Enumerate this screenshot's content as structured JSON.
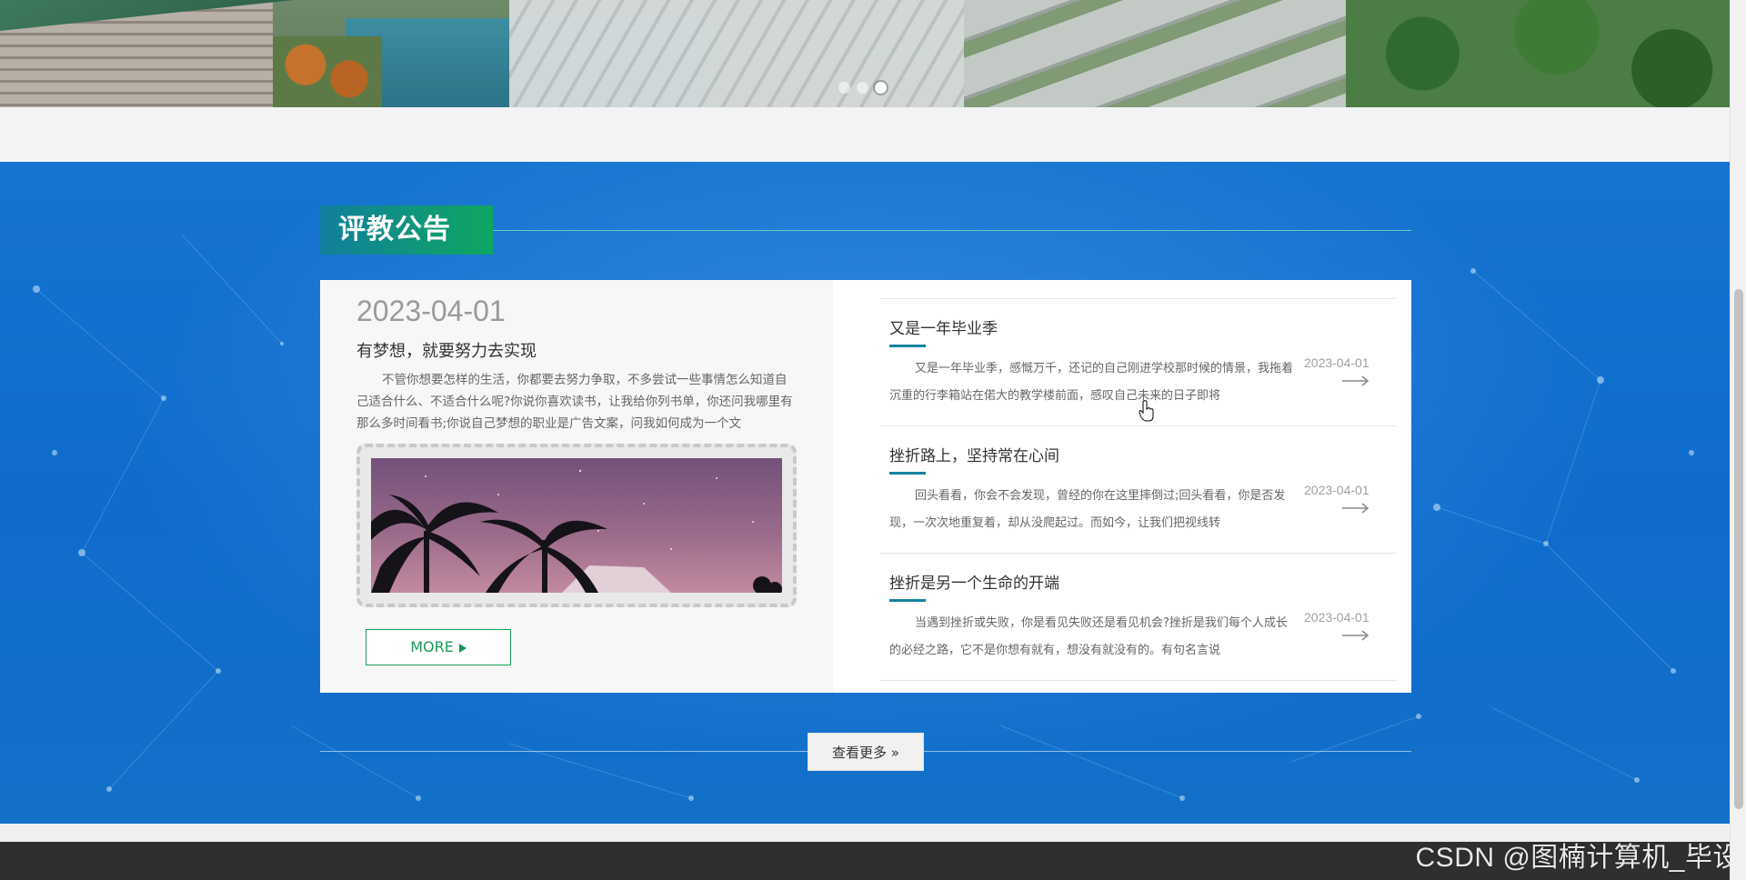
{
  "banner": {
    "slides": 3,
    "active_slide": 3
  },
  "section": {
    "title": "评教公告",
    "view_more_label": "查看更多 »",
    "colors": {
      "section_blue": "#1270c9",
      "title_green": "#0fa760",
      "title_teal": "#107f9c",
      "more_green": "#1a9a5a"
    }
  },
  "featured": {
    "date": "2023-04-01",
    "title": "有梦想，就要努力去实现",
    "text": "不管你想要怎样的生活，你都要去努力争取，不多尝试一些事情怎么知道自己适合什么、不适合什么呢?你说你喜欢读书，让我给你列书单，你还问我哪里有那么多时间看书;你说自己梦想的职业是广告文案，问我如何成为一个文",
    "more_label": "MORE",
    "image_icon": "palm-tree-photo"
  },
  "items": [
    {
      "title": "又是一年毕业季",
      "text": "又是一年毕业季，感慨万千，还记的自己刚进学校那时候的情景，我拖着沉重的行李箱站在偌大的教学楼前面，感叹自己未来的日子即将",
      "date": "2023-04-01"
    },
    {
      "title": "挫折路上，坚持常在心间",
      "text": "回头看看，你会不会发现，曾经的你在这里摔倒过;回头看看，你是否发现，一次次地重复着，却从没爬起过。而如今，让我们把视线转",
      "date": "2023-04-01"
    },
    {
      "title": "挫折是另一个生命的开端",
      "text": "当遇到挫折或失败，你是看见失败还是看见机会?挫折是我们每个人成长的必经之路，它不是你想有就有，想没有就没有的。有句名言说",
      "date": "2023-04-01"
    }
  ],
  "watermark": "CSDN @图楠计算机_毕设"
}
